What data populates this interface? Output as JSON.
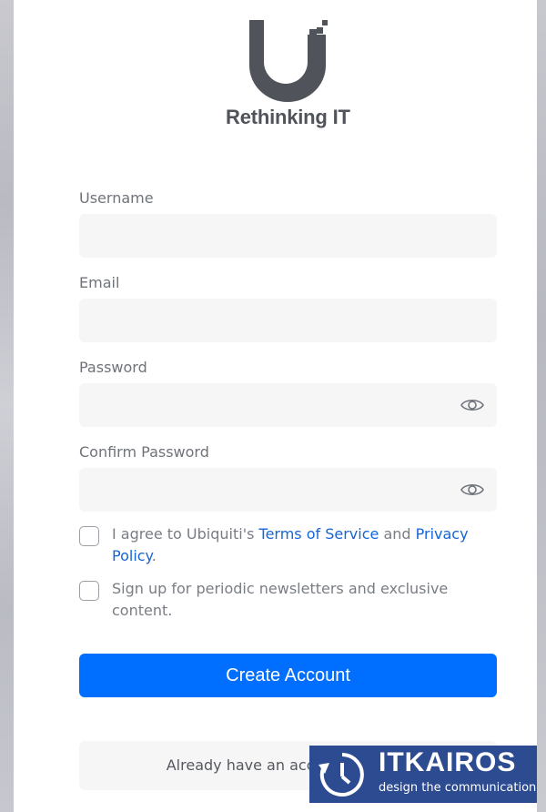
{
  "brand": {
    "name": "Rethinking IT"
  },
  "form": {
    "fields": [
      {
        "label": "Username",
        "value": "",
        "placeholder": ""
      },
      {
        "label": "Email",
        "value": "",
        "placeholder": ""
      },
      {
        "label": "Password",
        "value": "",
        "placeholder": ""
      },
      {
        "label": "Confirm Password",
        "value": "",
        "placeholder": ""
      }
    ],
    "terms": {
      "prefix": "I agree to Ubiquiti's ",
      "tos_link": "Terms of Service",
      "middle": " and ",
      "privacy_link": "Privacy Policy",
      "suffix": "."
    },
    "newsletter": "Sign up for periodic newsletters and exclusive content.",
    "submit_label": "Create Account",
    "signin_label": "Already have an account? Sign In"
  },
  "watermark": {
    "title": "ITKAIROS",
    "subtitle": "design the communication"
  },
  "colors": {
    "accent": "#006fff",
    "link": "#1565d8",
    "logo": "#50535a",
    "watermark_bg": "#2c4b91"
  },
  "icons": [
    "eye-icon",
    "logo-u-icon",
    "clock-arrow-icon"
  ]
}
